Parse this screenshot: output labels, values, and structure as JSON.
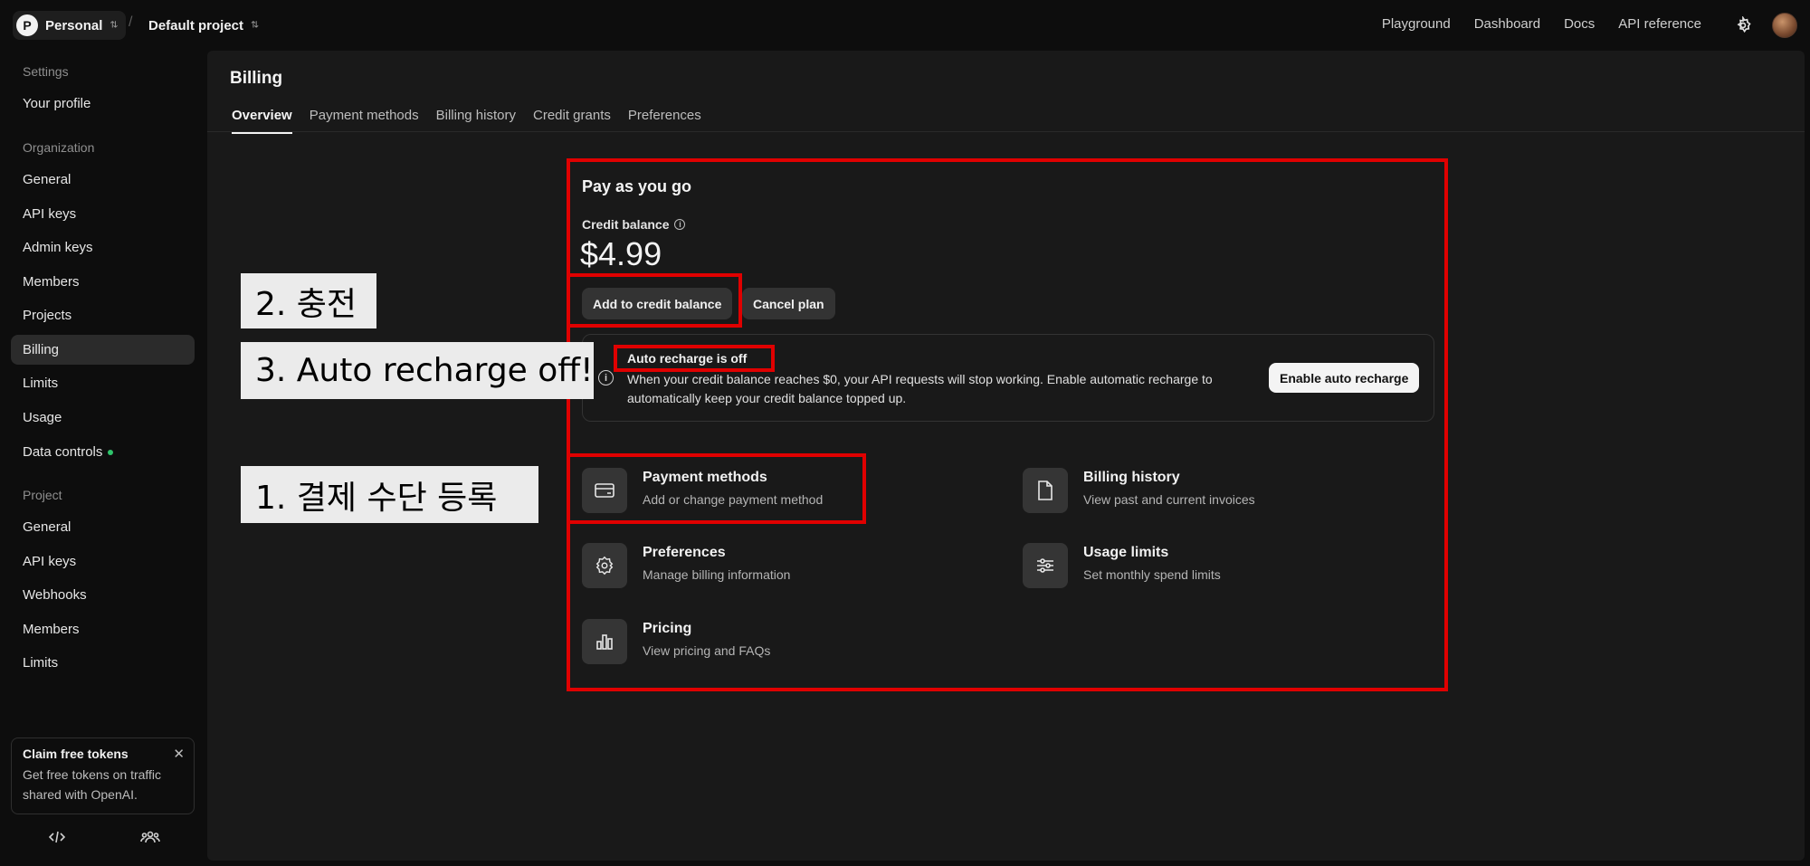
{
  "topbar": {
    "org_initial": "P",
    "org_name": "Personal",
    "project_name": "Default project",
    "links": [
      "Playground",
      "Dashboard",
      "Docs",
      "API reference"
    ],
    "settings_icon": "gear-icon",
    "avatar": "user-avatar"
  },
  "sidebar": {
    "sections": {
      "settings": "Settings",
      "organization": "Organization",
      "project": "Project"
    },
    "items": {
      "your_profile": "Your profile",
      "org_general": "General",
      "org_api_keys": "API keys",
      "admin_keys": "Admin keys",
      "org_members": "Members",
      "projects": "Projects",
      "billing": "Billing",
      "org_limits": "Limits",
      "usage": "Usage",
      "data_controls": "Data controls",
      "proj_general": "General",
      "proj_api_keys": "API keys",
      "webhooks": "Webhooks",
      "proj_members": "Members",
      "proj_limits": "Limits"
    },
    "claim": {
      "title": "Claim free tokens",
      "text": "Get free tokens on traffic shared with OpenAI."
    }
  },
  "main": {
    "title": "Billing",
    "tabs": [
      "Overview",
      "Payment methods",
      "Billing history",
      "Credit grants",
      "Preferences"
    ],
    "active_tab": "Overview",
    "plan_title": "Pay as you go",
    "credit_label": "Credit balance",
    "credit_amount": "$4.99",
    "add_credit_button": "Add to credit balance",
    "cancel_plan_button": "Cancel plan",
    "auto_recharge": {
      "title": "Auto recharge is off",
      "text": "When your credit balance reaches $0, your API requests will stop working. Enable automatic recharge to automatically keep your credit balance topped up.",
      "button": "Enable auto recharge"
    },
    "links": {
      "payment_methods": {
        "title": "Payment methods",
        "desc": "Add or change payment method",
        "icon": "credit-card-icon"
      },
      "billing_history": {
        "title": "Billing history",
        "desc": "View past and current invoices",
        "icon": "document-icon"
      },
      "preferences": {
        "title": "Preferences",
        "desc": "Manage billing information",
        "icon": "gear-icon"
      },
      "usage_limits": {
        "title": "Usage limits",
        "desc": "Set monthly spend limits",
        "icon": "sliders-icon"
      },
      "pricing": {
        "title": "Pricing",
        "desc": "View pricing and FAQs",
        "icon": "bar-chart-icon"
      }
    }
  },
  "annotations": {
    "label_2": "2. 충전",
    "label_3": "3. Auto recharge off!",
    "label_1": "1. 결제 수단 등록",
    "color": "#e00000"
  }
}
